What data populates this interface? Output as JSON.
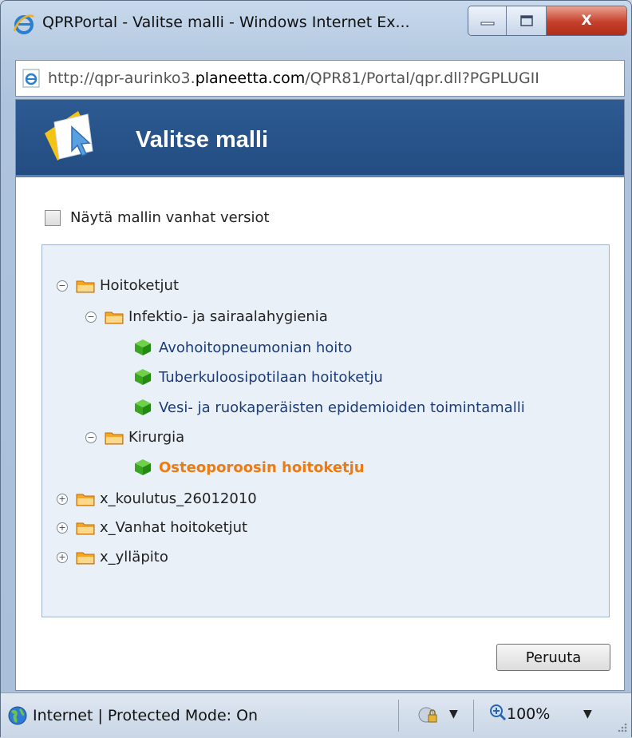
{
  "window": {
    "title": "QPRPortal - Valitse malli - Windows Internet Ex...",
    "close_glyph": "X"
  },
  "address": {
    "prefix": "http://qpr-aurinko3.",
    "domain": "planeetta.com",
    "suffix": "/QPR81/Portal/qpr.dll?PGPLUGII"
  },
  "header": {
    "title": "Valitse malli"
  },
  "options": {
    "show_old_versions_label": "Näytä mallin vanhat versiot"
  },
  "tree": {
    "root": {
      "label": "Hoitoketjut",
      "toggle": "−"
    },
    "infektio": {
      "label": "Infektio- ja sairaalahygienia",
      "toggle": "−"
    },
    "leaf1": {
      "label": "Avohoitopneumonian hoito"
    },
    "leaf2": {
      "label": "Tuberkuloosipotilaan hoitoketju"
    },
    "leaf3": {
      "label": "Vesi- ja ruokaperäisten epidemioiden toimintamalli"
    },
    "kirurgia": {
      "label": "Kirurgia",
      "toggle": "−"
    },
    "leaf4": {
      "label": "Osteoporoosin hoitoketju"
    },
    "koulutus": {
      "label": "x_koulutus_26012010",
      "toggle": "+"
    },
    "vanhat": {
      "label": "x_Vanhat hoitoketjut",
      "toggle": "+"
    },
    "yllapito": {
      "label": "x_ylläpito",
      "toggle": "+"
    }
  },
  "buttons": {
    "cancel": "Peruuta"
  },
  "status": {
    "zone": "Internet | Protected Mode: On",
    "zoom": "100%"
  },
  "colors": {
    "header_bg": "#234d82",
    "selected_item": "#ee7a12",
    "leaf_link": "#1c3d7a",
    "tree_bg": "#eaf0f7"
  }
}
